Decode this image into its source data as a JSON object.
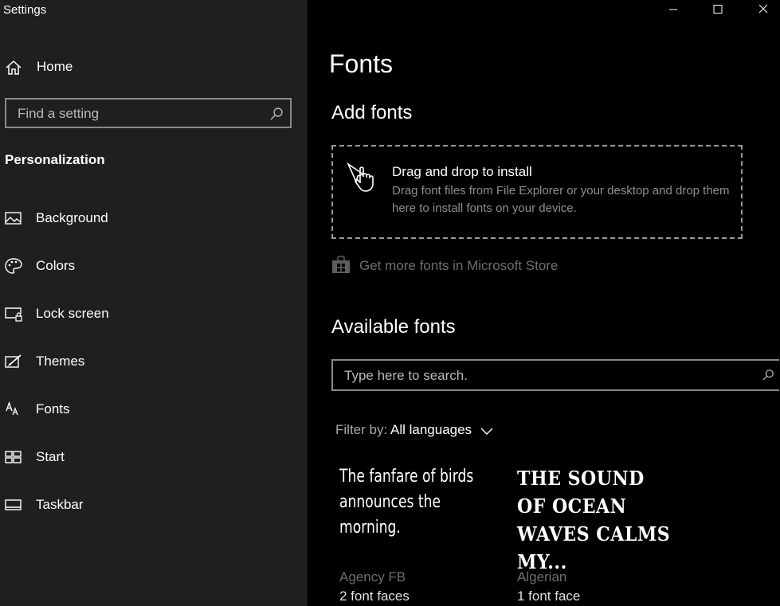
{
  "app": {
    "title": "Settings"
  },
  "window": {
    "minimize_icon": "minimize-icon",
    "maximize_icon": "maximize-icon",
    "close_icon": "close-icon"
  },
  "sidebar": {
    "home_label": "Home",
    "search_placeholder": "Find a setting",
    "section_title": "Personalization",
    "items": [
      {
        "label": "Background",
        "icon": "picture-icon"
      },
      {
        "label": "Colors",
        "icon": "palette-icon"
      },
      {
        "label": "Lock screen",
        "icon": "lock-screen-icon"
      },
      {
        "label": "Themes",
        "icon": "themes-icon"
      },
      {
        "label": "Fonts",
        "icon": "fonts-icon"
      },
      {
        "label": "Start",
        "icon": "start-icon"
      },
      {
        "label": "Taskbar",
        "icon": "taskbar-icon"
      }
    ]
  },
  "main": {
    "title": "Fonts",
    "add_fonts_heading": "Add fonts",
    "drop_zone": {
      "title": "Drag and drop to install",
      "description": "Drag font files from File Explorer or your desktop and drop them here to install fonts on your device."
    },
    "store_link": "Get more fonts in Microsoft Store",
    "available_heading": "Available fonts",
    "search_placeholder": "Type here to search.",
    "filter_label": "Filter by:",
    "filter_value": "All languages",
    "fonts": [
      {
        "preview": "The fanfare of birds announces the morning.",
        "name": "Agency FB",
        "faces": "2 font faces"
      },
      {
        "preview": "THE SOUND OF OCEAN WAVES CALMS MY...",
        "name": "Algerian",
        "faces": "1 font face"
      }
    ]
  },
  "colors": {
    "sidebar_bg": "#1f1f1f",
    "main_bg": "#000000",
    "muted_text": "#6e6e6e",
    "border": "#8a8a8a"
  }
}
